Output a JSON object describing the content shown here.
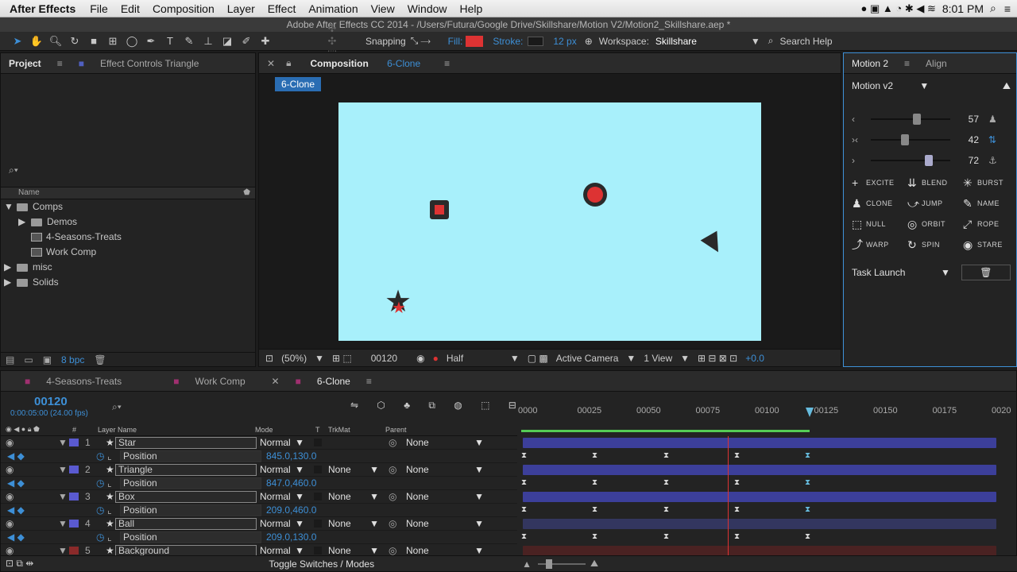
{
  "macmenu": {
    "apple": "",
    "app": "After Effects",
    "items": [
      "File",
      "Edit",
      "Composition",
      "Layer",
      "Effect",
      "Animation",
      "View",
      "Window",
      "Help"
    ],
    "clock": "8:01 PM"
  },
  "title": "Adobe After Effects CC 2014 - /Users/Futura/Google Drive/Skillshare/Motion V2/Motion2_Skillshare.aep *",
  "toolbar": {
    "snapping": "Snapping",
    "fill": "Fill:",
    "stroke": "Stroke:",
    "stroke_px": "12 px",
    "workspace_label": "Workspace:",
    "workspace": "Skillshare",
    "search": "Search Help"
  },
  "project": {
    "tab": "Project",
    "effect_tab": "Effect Controls Triangle",
    "search_icon": "search-icon",
    "col_name": "Name",
    "bpc": "8 bpc",
    "items": [
      {
        "label": "Comps",
        "kind": "folder",
        "depth": 0,
        "open": true
      },
      {
        "label": "Demos",
        "kind": "folder",
        "depth": 1,
        "open": false
      },
      {
        "label": "4-Seasons-Treats",
        "kind": "comp",
        "depth": 1
      },
      {
        "label": "Work Comp",
        "kind": "comp",
        "depth": 1
      },
      {
        "label": "misc",
        "kind": "folder",
        "depth": 0,
        "open": false
      },
      {
        "label": "Solids",
        "kind": "folder",
        "depth": 0,
        "open": false
      }
    ]
  },
  "composition": {
    "tab_prefix": "Composition",
    "tab_name": "6-Clone",
    "breadcrumb": "6-Clone",
    "zoom": "(50%)",
    "timecode": "00120",
    "resolution": "Half",
    "camera": "Active Camera",
    "views": "1 View",
    "exposure": "+0.0",
    "bg": "#a8f0fb"
  },
  "motion": {
    "tab": "Motion 2",
    "align_tab": "Align",
    "preset": "Motion v2",
    "sliders": [
      57,
      42,
      72
    ],
    "buttons": [
      [
        "EXCITE",
        "BLEND",
        "BURST"
      ],
      [
        "CLONE",
        "JUMP",
        "NAME"
      ],
      [
        "NULL",
        "ORBIT",
        "ROPE"
      ],
      [
        "WARP",
        "SPIN",
        "STARE"
      ]
    ],
    "task": "Task Launch"
  },
  "timeline": {
    "tabs": [
      "4-Seasons-Treats",
      "Work Comp",
      "6-Clone"
    ],
    "timecode": "00120",
    "time_sub": "0:00:05:00 (24.00 fps)",
    "cols": {
      "hash": "#",
      "layer": "Layer Name",
      "mode": "Mode",
      "t": "T",
      "trk": "TrkMat",
      "parent": "Parent"
    },
    "ruler": [
      "0000",
      "00025",
      "00050",
      "00075",
      "00100",
      "00125",
      "00150",
      "00175",
      "0020"
    ],
    "layers": [
      {
        "num": "1",
        "name": "Star",
        "mode": "Normal",
        "trk": "",
        "parent": "None",
        "pos": "845.0,130.0",
        "color": "#5a5ad0"
      },
      {
        "num": "2",
        "name": "Triangle",
        "mode": "Normal",
        "trk": "None",
        "parent": "None",
        "pos": "847.0,460.0",
        "color": "#5a5ad0"
      },
      {
        "num": "3",
        "name": "Box",
        "mode": "Normal",
        "trk": "None",
        "parent": "None",
        "pos": "209.0,460.0",
        "color": "#5a5ad0"
      },
      {
        "num": "4",
        "name": "Ball",
        "mode": "Normal",
        "trk": "None",
        "parent": "None",
        "pos": "209.0,130.0",
        "color": "#5a5ad0"
      },
      {
        "num": "5",
        "name": "Background",
        "mode": "Normal",
        "trk": "None",
        "parent": "None",
        "pos": "",
        "color": "#8a2a2a"
      }
    ],
    "position_label": "Position",
    "toggle": "Toggle Switches / Modes"
  }
}
